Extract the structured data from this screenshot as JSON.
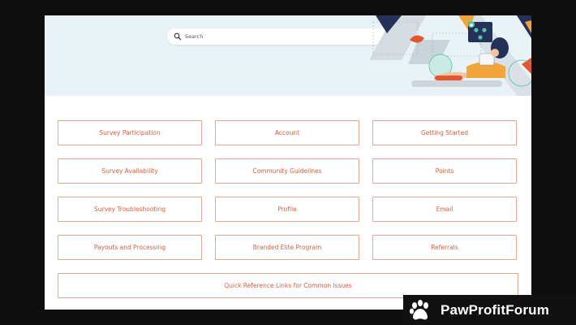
{
  "search": {
    "placeholder": "Search"
  },
  "categories": [
    "Survey Participation",
    "Account",
    "Getting Started",
    "Survey Availability",
    "Community Guidelines",
    "Points",
    "Survey Troubleshooting",
    "Profile",
    "Email",
    "Payouts and Processing",
    "Branded Elite Program",
    "Referrals"
  ],
  "quick_links": "Quick Reference Links for Common Issues",
  "watermark": {
    "text": "PawProfitForum"
  },
  "colors": {
    "accent": "#d2603c",
    "tile_border": "#e7a68f",
    "hero_bg": "#e9f2f7"
  }
}
